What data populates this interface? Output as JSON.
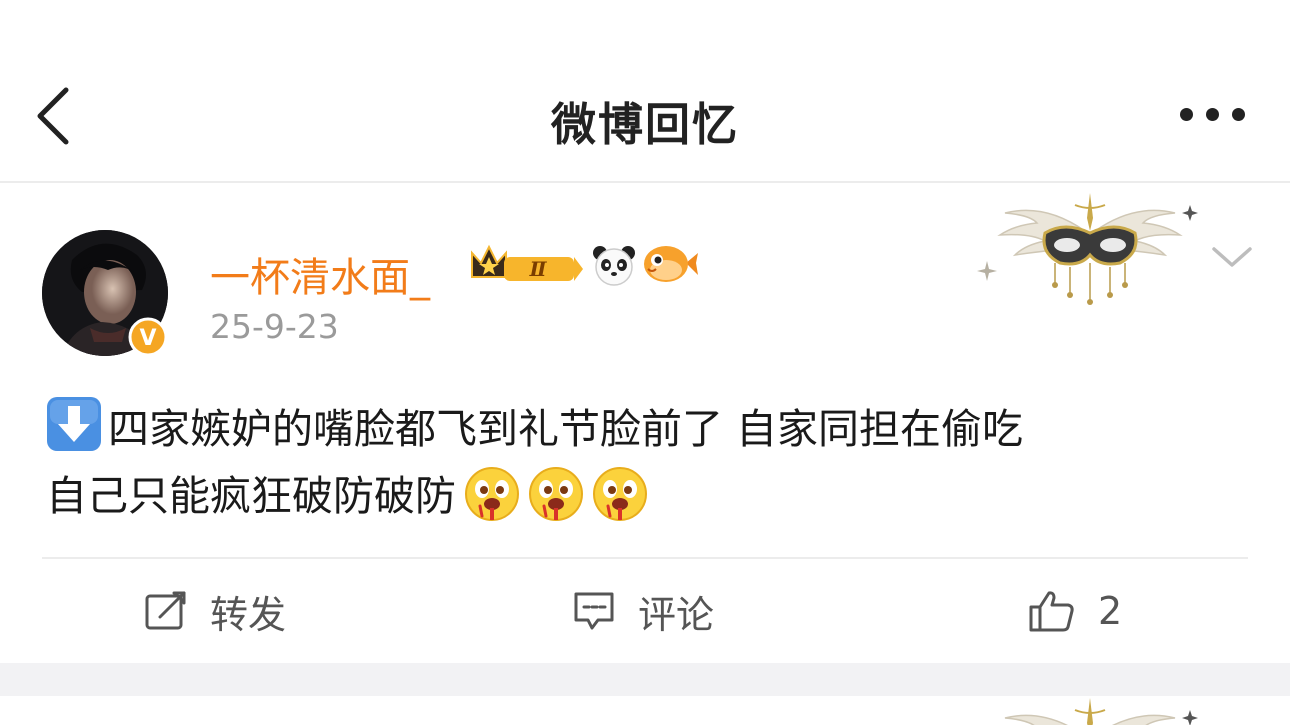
{
  "header": {
    "title": "微博回忆",
    "back_icon": "chevron-left-icon",
    "more_icon": "more-dots-icon"
  },
  "post": {
    "username": "一杯清水面_",
    "date": "25-9-23",
    "badge_level": "Ⅱ",
    "content_line1": "四家嫉妒的嘴脸都飞到礼节脸前了 自家同担在偷吃",
    "content_line2": "自己只能疯狂破防破防",
    "verified_badge": "V",
    "colors": {
      "username": "#f27c19",
      "date": "#9a9a9a",
      "badge_orange": "#f5a623"
    }
  },
  "actions": {
    "repost_label": "转发",
    "comment_label": "评论",
    "like_count": "2"
  }
}
